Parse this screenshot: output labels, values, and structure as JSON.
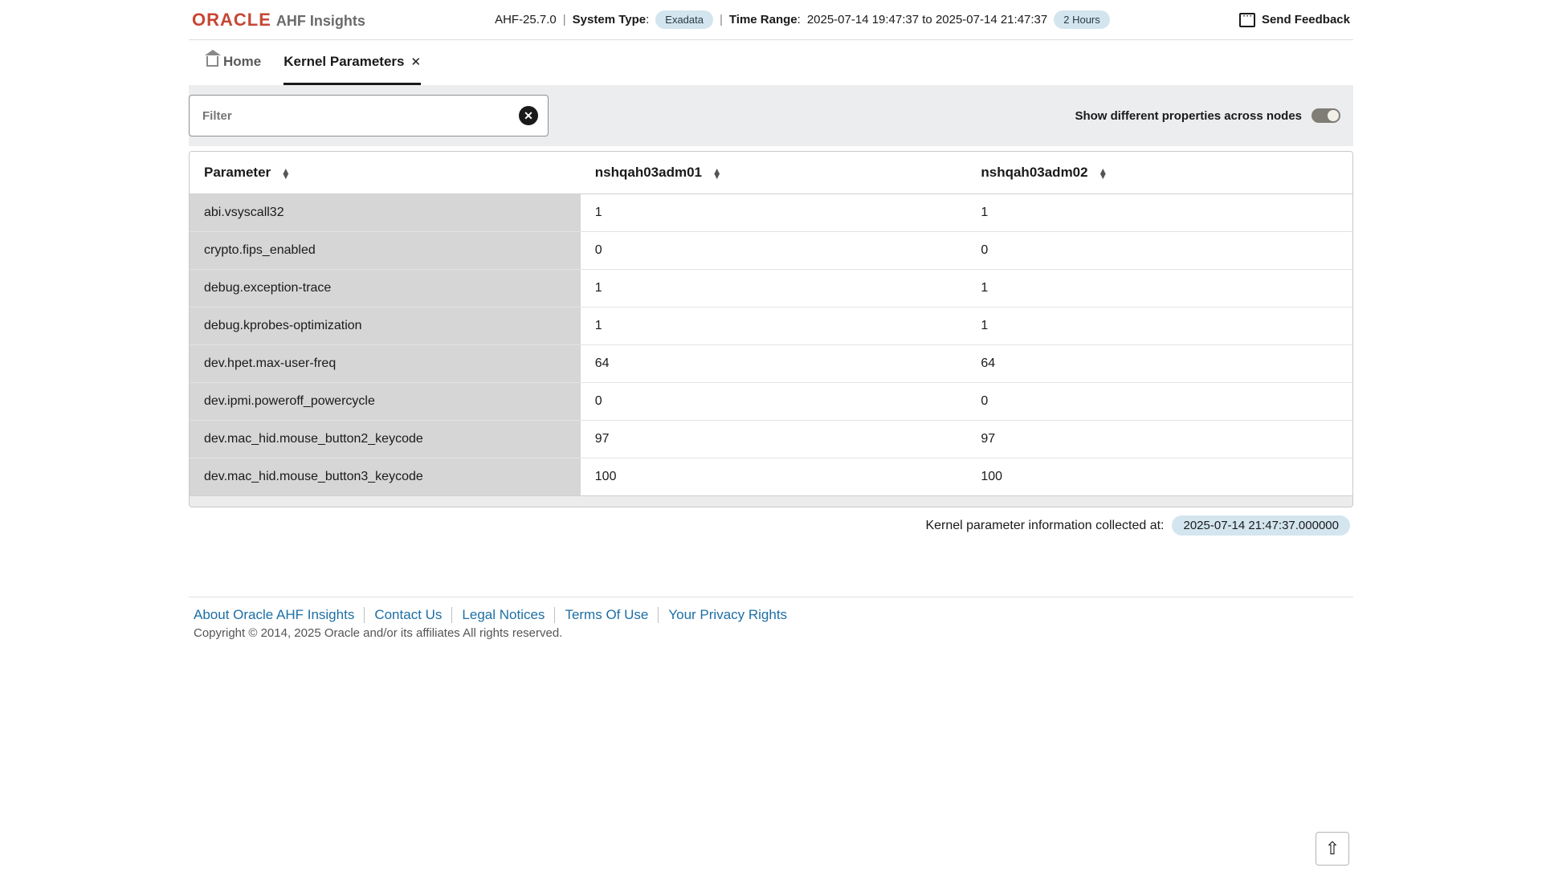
{
  "header": {
    "brand": "ORACLE",
    "app": "AHF Insights",
    "version": "AHF-25.7.0",
    "systemTypeLabel": "System Type",
    "systemType": "Exadata",
    "timeRangeLabel": "Time Range",
    "timeRange": "2025-07-14 19:47:37 to 2025-07-14 21:47:37",
    "timeRangeDur": "2 Hours",
    "feedback": "Send Feedback"
  },
  "tabs": {
    "home": "Home",
    "kernel": "Kernel Parameters"
  },
  "filter": {
    "placeholder": "Filter",
    "diffLabel": "Show different properties across nodes"
  },
  "columns": {
    "param": "Parameter",
    "node1": "nshqah03adm01",
    "node2": "nshqah03adm02"
  },
  "rows": [
    {
      "p": "abi.vsyscall32",
      "a": "1",
      "b": "1"
    },
    {
      "p": "crypto.fips_enabled",
      "a": "0",
      "b": "0"
    },
    {
      "p": "debug.exception-trace",
      "a": "1",
      "b": "1"
    },
    {
      "p": "debug.kprobes-optimization",
      "a": "1",
      "b": "1"
    },
    {
      "p": "dev.hpet.max-user-freq",
      "a": "64",
      "b": "64"
    },
    {
      "p": "dev.ipmi.poweroff_powercycle",
      "a": "0",
      "b": "0"
    },
    {
      "p": "dev.mac_hid.mouse_button2_keycode",
      "a": "97",
      "b": "97"
    },
    {
      "p": "dev.mac_hid.mouse_button3_keycode",
      "a": "100",
      "b": "100"
    }
  ],
  "collected": {
    "label": "Kernel parameter information collected at:",
    "ts": "2025-07-14 21:47:37.000000"
  },
  "footer": {
    "links": [
      "About Oracle AHF Insights",
      "Contact Us",
      "Legal Notices",
      "Terms Of Use",
      "Your Privacy Rights"
    ],
    "copyright": "Copyright © 2014, 2025 Oracle and/or its affiliates All rights reserved."
  }
}
